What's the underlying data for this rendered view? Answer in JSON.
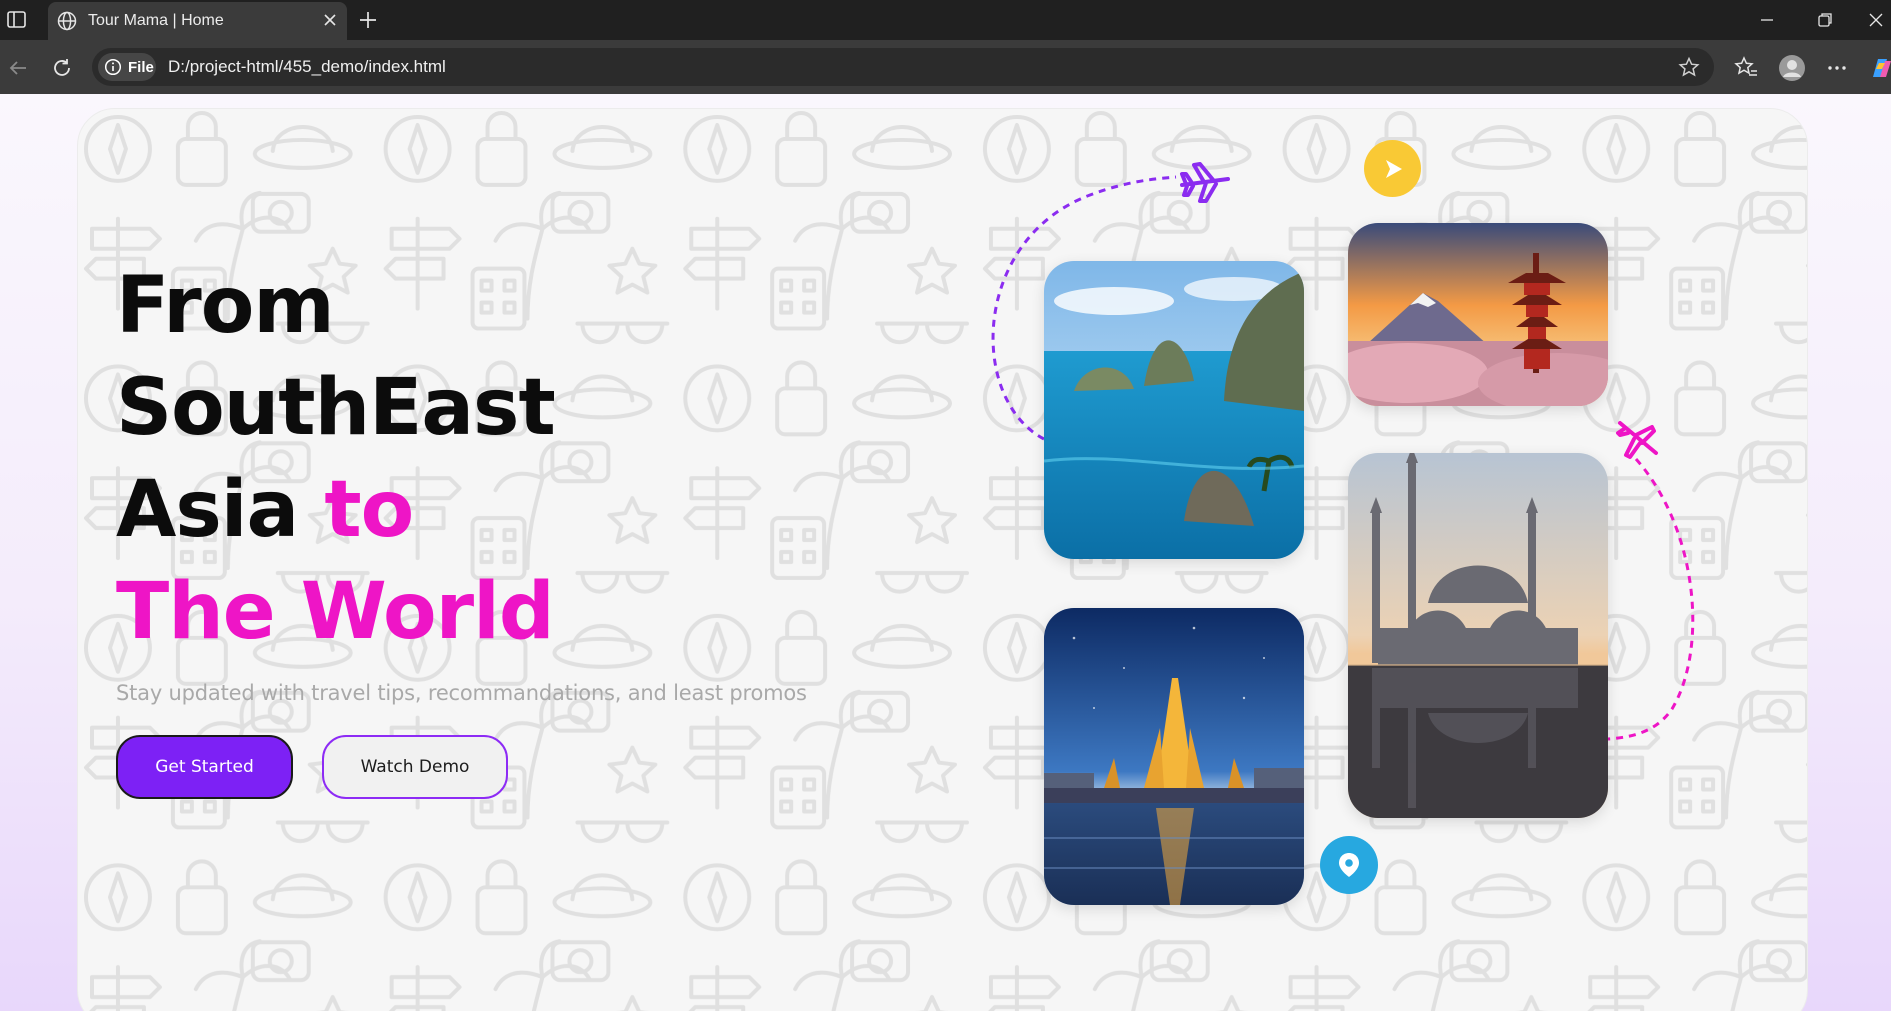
{
  "browser": {
    "tab_title": "Tour Mama | Home",
    "site_info_label": "File",
    "url": "D:/project-html/455_demo/index.html"
  },
  "hero": {
    "headline_line1": "From",
    "headline_line2": "SouthEast",
    "headline_line3_dark": "Asia",
    "headline_line3_pink": "to",
    "headline_line4_pink": "The World",
    "subtitle": "Stay updated with travel tips, recommandations, and least promos",
    "primary_button": "Get Started",
    "secondary_button": "Watch Demo"
  },
  "colors": {
    "accent_pink": "#ee15c6",
    "accent_purple": "#7d21f5",
    "badge_yellow": "#f9c935",
    "badge_blue": "#27a8e0"
  },
  "icons": {
    "play_badge": "play-icon",
    "pin_badge": "location-pin-icon",
    "planes": "airplane-icon"
  }
}
